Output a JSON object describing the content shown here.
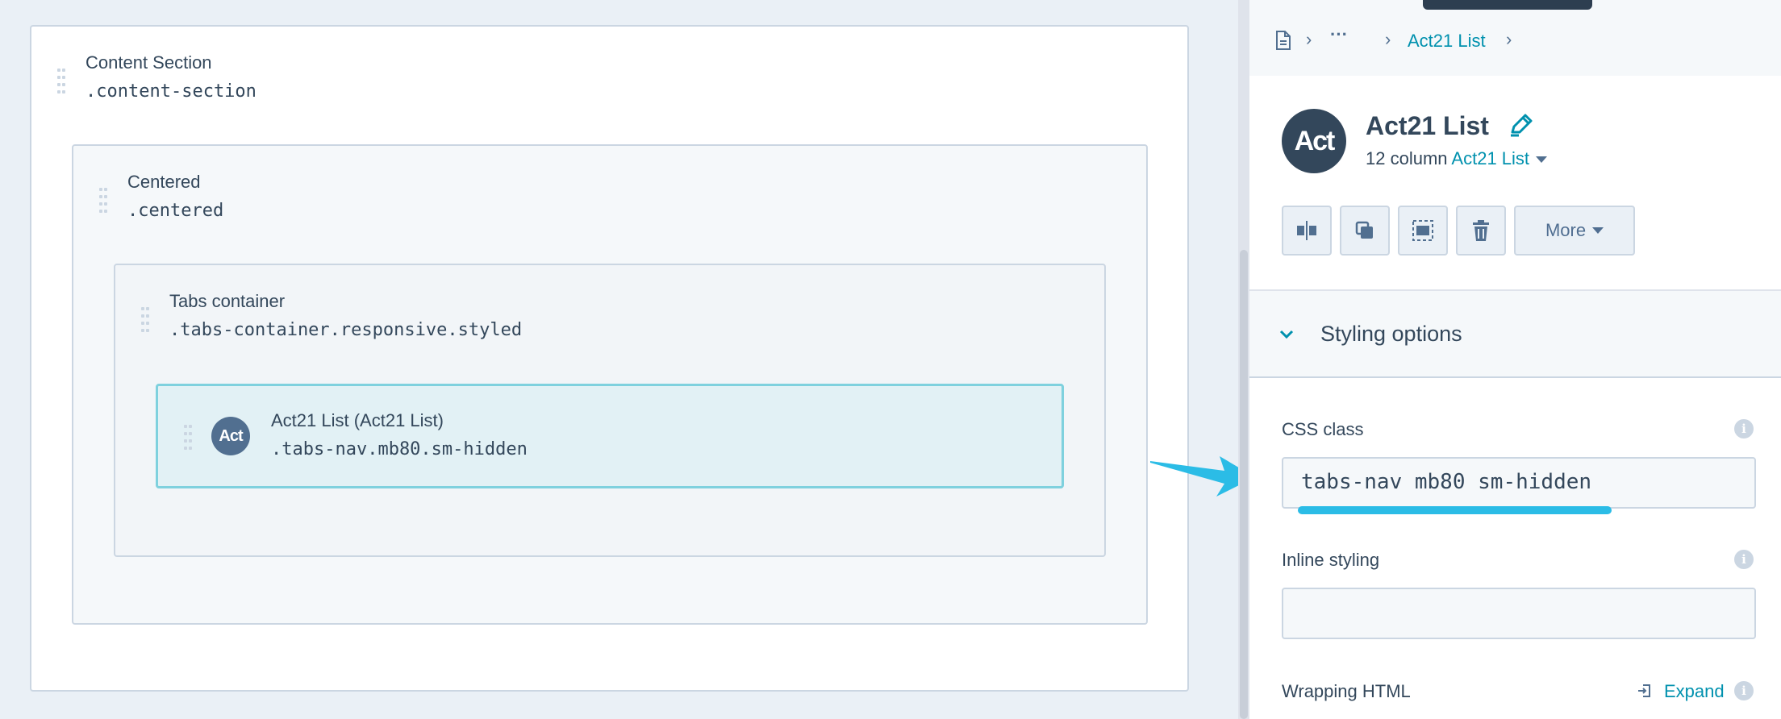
{
  "canvas": {
    "content_section": {
      "title": "Content Section",
      "css": ".content-section"
    },
    "centered": {
      "title": "Centered",
      "css": ".centered"
    },
    "tabs_container": {
      "title": "Tabs container",
      "css": ".tabs-container.responsive.styled"
    },
    "act21_module": {
      "title": "Act21 List (Act21 List)",
      "css": ".tabs-nav.mb80.sm-hidden",
      "avatar": "Act"
    }
  },
  "panel": {
    "breadcrumb": {
      "page_icon": "page-icon",
      "ellipsis": "···",
      "current": "Act21 List"
    },
    "module": {
      "avatar": "Act",
      "name": "Act21 List",
      "sub_prefix": "12 column",
      "sub_link": "Act21 List"
    },
    "toolbar": {
      "more_label": "More",
      "icons": [
        "split-column-icon",
        "duplicate-icon",
        "select-all-icon",
        "trash-icon"
      ]
    },
    "styling": {
      "header": "Styling options",
      "css_class_label": "CSS class",
      "css_class_value": "tabs-nav mb80 sm-hidden",
      "inline_label": "Inline styling",
      "inline_value": "",
      "wrapping_label": "Wrapping HTML",
      "expand_label": "Expand"
    }
  },
  "colors": {
    "accent": "#0091ae",
    "highlight": "#2bbce6",
    "selected_bg": "#e2f1f5",
    "selected_border": "#7fd1de",
    "dark": "#33475b"
  }
}
